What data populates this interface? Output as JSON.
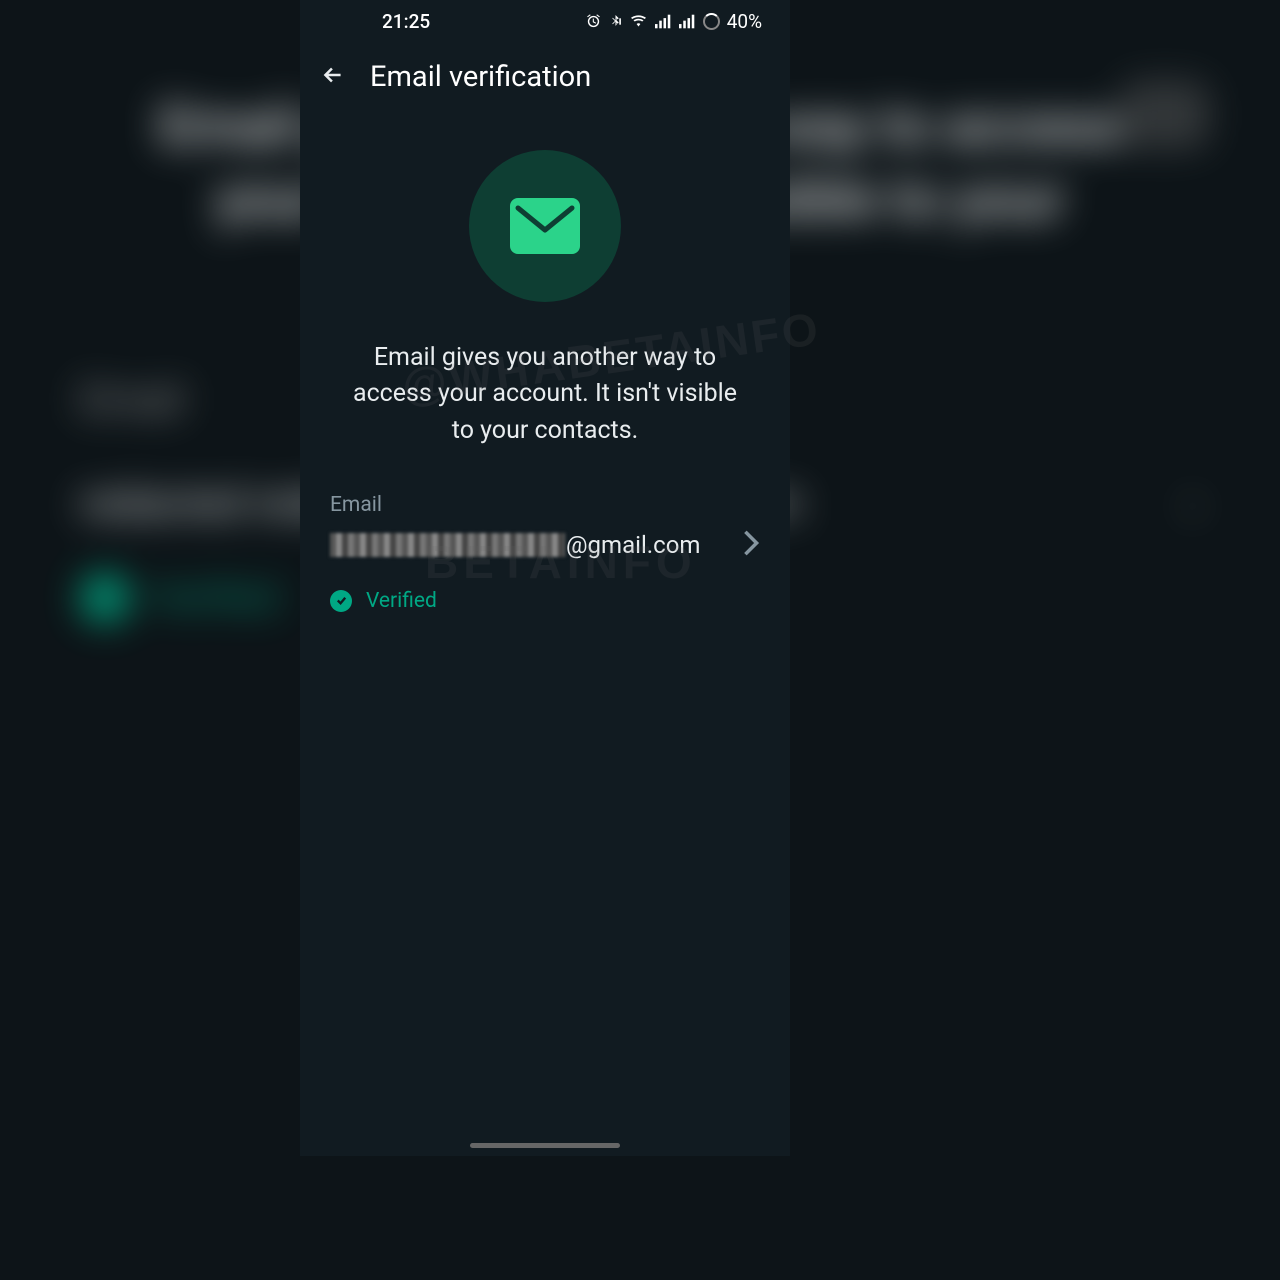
{
  "statusBar": {
    "time": "21:25",
    "batteryPercent": "40%"
  },
  "header": {
    "title": "Email verification"
  },
  "hero": {
    "description": "Email gives you another way to access your account. It isn't visible to your contacts."
  },
  "emailField": {
    "label": "Email",
    "valueSuffix": "@gmail.com"
  },
  "status": {
    "text": "Verified"
  },
  "watermark": {
    "line1": "@WHABETAINFO",
    "line2": "BETAINFO"
  }
}
